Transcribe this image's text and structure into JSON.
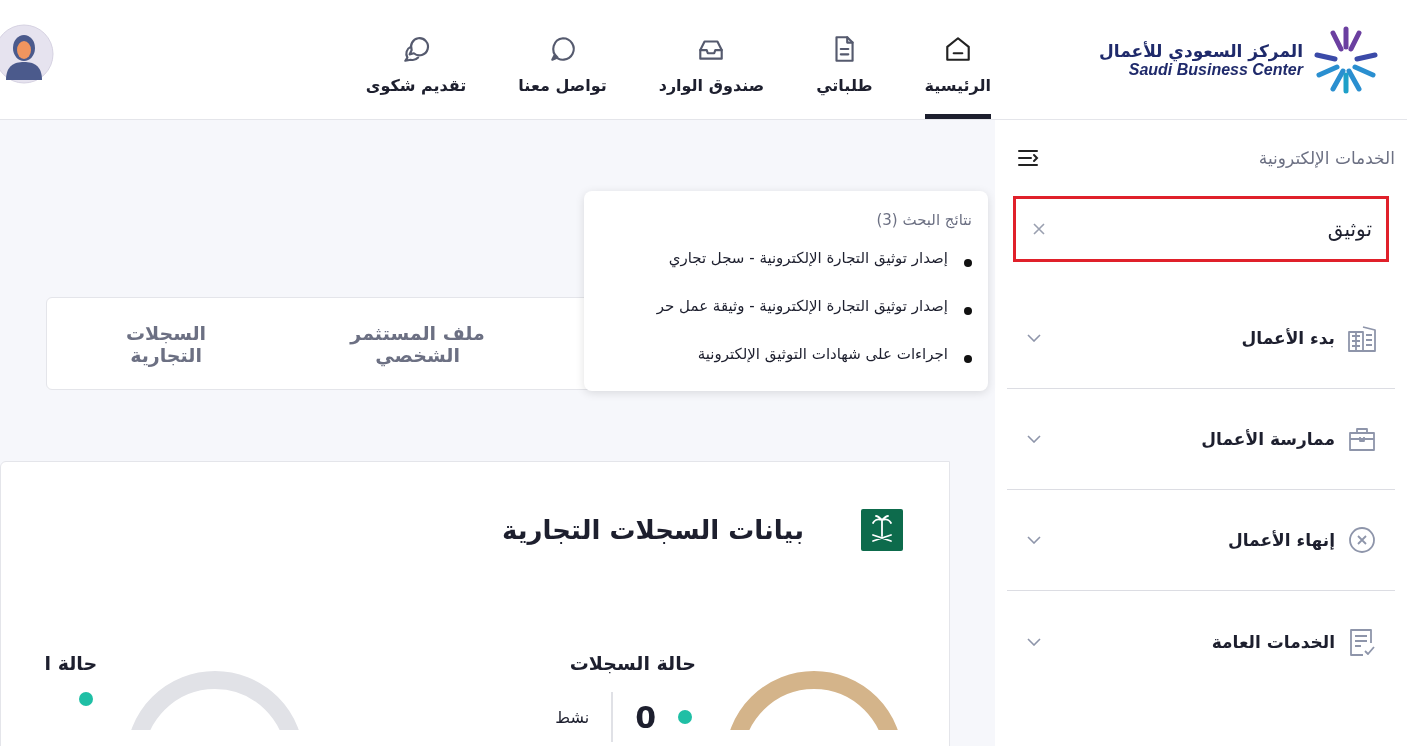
{
  "logo": {
    "arabic": "المركز السعودي للأعمال",
    "english": "Saudi Business Center"
  },
  "nav": [
    {
      "label": "الرئيسية",
      "kind": "home",
      "selected": true
    },
    {
      "label": "طلباتي",
      "kind": "document",
      "selected": false
    },
    {
      "label": "صندوق الوارد",
      "kind": "inbox",
      "selected": false
    },
    {
      "label": "تواصل معنا",
      "kind": "chat",
      "selected": false
    },
    {
      "label": "تقديم شكوى",
      "kind": "chats",
      "selected": false
    }
  ],
  "sidebar": {
    "title": "الخدمات الإلكترونية",
    "search": {
      "value": "توثيق"
    },
    "items": [
      {
        "label": "بدء الأعمال",
        "kind": "building"
      },
      {
        "label": "ممارسة الأعمال",
        "kind": "briefcase"
      },
      {
        "label": "إنهاء الأعمال",
        "kind": "cancel"
      },
      {
        "label": "الخدمات العامة",
        "kind": "checklist"
      }
    ]
  },
  "search_results": {
    "title": "نتائج البحث (3)",
    "items": [
      "إصدار توثيق التجارة الإلكترونية - سجل تجاري",
      "إصدار توثيق التجارة الإلكترونية - وثيقة عمل حر",
      "اجراءات على شهادات التوثيق الإلكترونية"
    ]
  },
  "tabs": [
    {
      "label": "ملف المستثمر الشخصي",
      "selected": false
    },
    {
      "label": "السجلات التجارية",
      "selected": false
    }
  ],
  "records_card": {
    "title": "بيانات السجلات التجارية",
    "panels": [
      {
        "title": "حالة السجلات",
        "color": "#d4b48a",
        "items": [
          {
            "color": "#1fbfa5",
            "count": "0",
            "label": "نشط"
          }
        ]
      },
      {
        "title": "حالة ا",
        "color": "#e1e2e7",
        "items": [
          {
            "color": "#1fbfa5"
          }
        ]
      }
    ]
  }
}
